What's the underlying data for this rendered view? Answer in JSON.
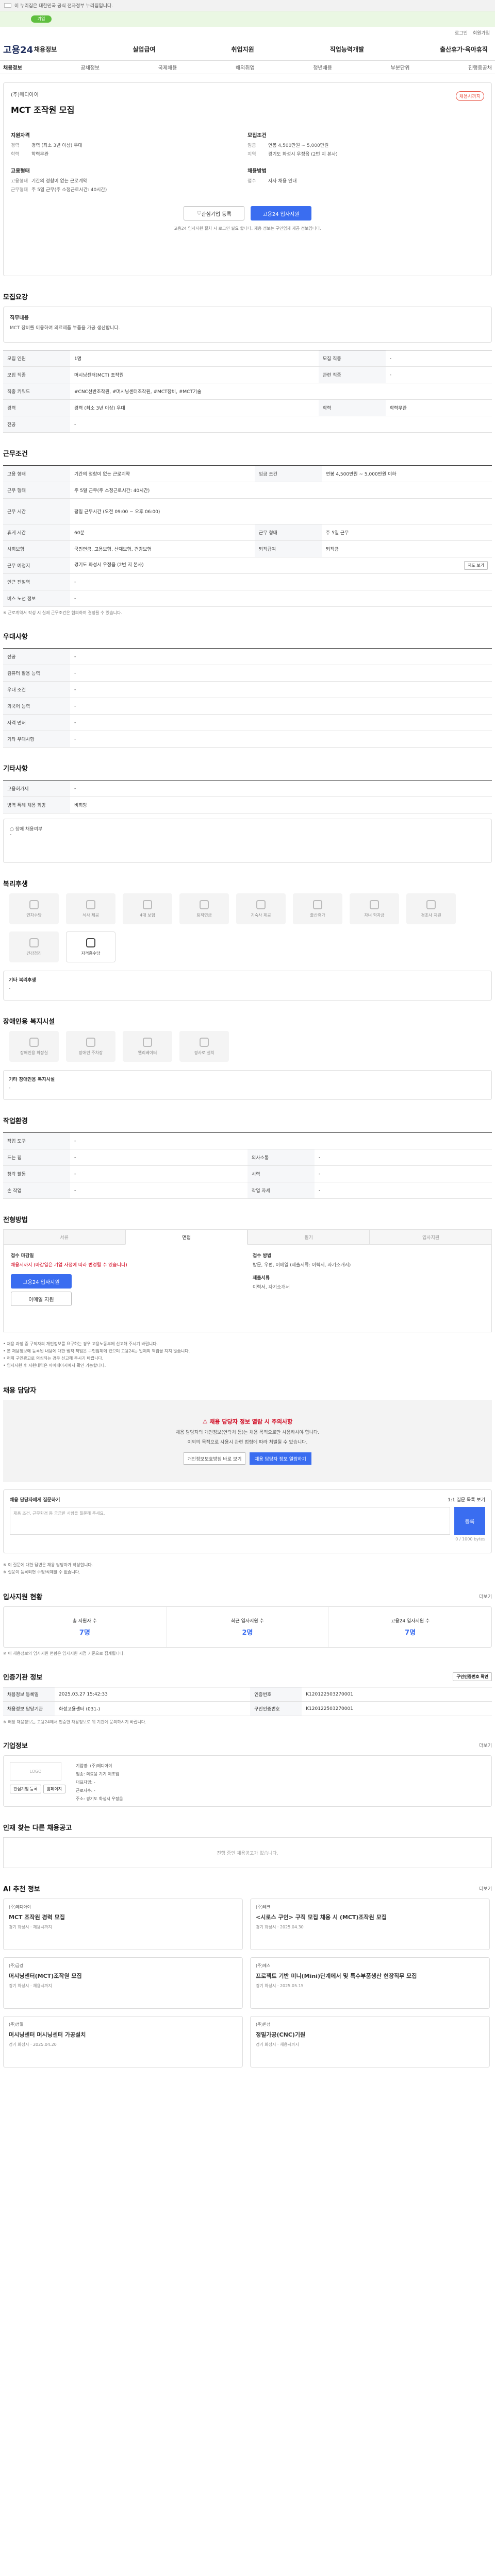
{
  "gov": "이 누리집은 대한민국 공식 전자정부 누리집입니다.",
  "notice": {
    "tag": "기업",
    "text": ""
  },
  "utility": [
    "로그인",
    "회원가입"
  ],
  "logo": "고용24",
  "gnb": [
    "채용정보",
    "실업급여",
    "취업지원",
    "직업능력개발",
    "출산휴가·육아휴직"
  ],
  "subnav": [
    "채용정보",
    "공채정보",
    "국제채용",
    "해외취업",
    "청년채용",
    "부분단위",
    "진행중공채"
  ],
  "summary": {
    "company": "(주)메디아이",
    "title": "MCT 조작원 모집",
    "badge": "채용시까지",
    "left_h1": "지원자격",
    "left_rows": [
      [
        "경력",
        "경력 (최소 3년 이상) 우대"
      ],
      [
        "학력",
        "학력무관"
      ]
    ],
    "left_h2": "고용형태",
    "left_rows2": [
      [
        "고용형태",
        "기간의 정함이 없는 근로계약"
      ],
      [
        "근무형태",
        "주 5일 근무(주 소정근로시간: 40시간)"
      ]
    ],
    "right_h1": "모집조건",
    "right_rows": [
      [
        "임금",
        "연봉 4,500만원 ~ 5,000만원"
      ],
      [
        "지역",
        "경기도 화성시 우정읍 (2번 지 본사)"
      ]
    ],
    "right_h2": "채용방법",
    "right_rows2": [
      [
        "접수",
        "자사 채용 안내"
      ]
    ],
    "btn_left": "관심기업 등록",
    "btn_right": "고용24 입사지원",
    "btns_note": "고용24 입사지원 절차 시 로그인 필요 합니다. 채용 정보는 구인업체 제공 정보입니다."
  },
  "intro": {
    "section": "모집요강",
    "h": "직무내용",
    "p": "MCT 장비를 이용하여 의료제품 부품을 가공 생산합니다."
  },
  "recruit_rows": [
    [
      "모집 인원",
      "1명",
      "모집 직종",
      "-"
    ],
    [
      "모집 직종",
      "머시닝센터(MCT) 조작원",
      "관련 직종",
      "-"
    ],
    [
      "직종 키워드",
      "#CNC선반조작원, #머시닝센터조작원, #MCT장비, #MCT기술",
      "",
      ""
    ],
    [
      "경력",
      "경력 (최소 3년 이상) 우대",
      "학력",
      "학력무관"
    ],
    [
      "전공",
      "-",
      "",
      ""
    ]
  ],
  "cond": {
    "section": "근무조건",
    "rows": [
      [
        "고용 형태",
        "기간의 정함이 없는 근로계약",
        "임금 조건",
        "연봉 4,500만원 ~ 5,000만원 이하"
      ],
      [
        "근무 형태",
        "주 5일 근무(주 소정근로시간: 40시간)",
        "",
        ""
      ],
      [
        "근무 시간",
        "평일 근무시간 (오전 09:00 ~ 오후 06:00)",
        "",
        ""
      ],
      [
        "휴게 시간",
        "60분",
        "근무 형태",
        "주 5일 근무"
      ],
      [
        "사회보험",
        "국민연금, 고용보험, 산재보험, 건강보험",
        "퇴직급여",
        "퇴직금"
      ],
      [
        "근무 예정지",
        "경기도 화성시 우정읍 (2번 지 본사)",
        "",
        ""
      ],
      [
        "인근 전철역",
        "-",
        "",
        ""
      ],
      [
        "버스 노선 정보",
        "-",
        "",
        ""
      ]
    ],
    "map_btn": "지도 보기",
    "note": "※ 근로계약서 작성 시 실제 근무조건은 협의하여 결정될 수 있습니다."
  },
  "prefer": {
    "section": "우대사항",
    "rows": [
      [
        "전공",
        "-"
      ],
      [
        "컴퓨터 활용 능력",
        "-"
      ],
      [
        "우대 조건",
        "-"
      ],
      [
        "외국어 능력",
        "-"
      ],
      [
        "자격 면허",
        "-"
      ],
      [
        "기타 우대사항",
        "-"
      ]
    ]
  },
  "etc": {
    "section": "기타사항",
    "rows": [
      [
        "고용허가제",
        "-"
      ],
      [
        "병역 특례 채용 희망",
        "비희망"
      ]
    ],
    "apply_note": "○ 장애 채용여부",
    "apply_val": "-"
  },
  "welfare": {
    "section": "복리후생",
    "cards": [
      [
        "연차수당",
        false
      ],
      [
        "식사 제공",
        false
      ],
      [
        "4대 보험",
        false
      ],
      [
        "퇴직연금",
        false
      ],
      [
        "기숙사 제공",
        false
      ],
      [
        "출산휴가",
        false
      ],
      [
        "자녀 학자금",
        false
      ],
      [
        "경조사 지원",
        false
      ],
      [
        "건강검진",
        false
      ],
      [
        "자격증수당",
        true
      ]
    ],
    "etc_h": "기타 복리후생",
    "etc_p": "-"
  },
  "disability": {
    "section": "장애인용 복지시설",
    "cards": [
      "장애인용 화장실",
      "장애인 주차장",
      "엘리베이터",
      "경사로 설치"
    ],
    "etc_h": "기타 장애인용 복지시설",
    "etc_p": "-"
  },
  "workenv": {
    "section": "작업환경",
    "rows": [
      [
        "작업 도구",
        "-",
        "",
        ""
      ],
      [
        "드는 힘",
        "-",
        "의사소통",
        "-"
      ],
      [
        "청각 활동",
        "-",
        "시력",
        "-"
      ],
      [
        "손 작업",
        "-",
        "작업 자세",
        "-"
      ]
    ]
  },
  "howto": {
    "section": "전형방법",
    "tabs": [
      "서류",
      "면접",
      "필기",
      "입사지원"
    ],
    "h1": "접수 마감일",
    "p1": "채용시까지 (마감일은 기업 사정에 따라 변경될 수 있습니다)",
    "apply_btn": "고용24 입사지원",
    "sub_btn": "이메일 지원",
    "h2": "접수 방법",
    "p2": "방문, 우편, 이메일 (제출서류: 이력서, 자기소개서)",
    "h3": "제출서류",
    "p3": "이력서, 자기소개서",
    "bullets": [
      "채용 과정 중 구직자의 개인정보를 요구하는 경우 고용노동부에 신고해 주시기 바랍니다.",
      "본 채용정보에 등록된 내용에 대한 법적 책임은 구인업체에 있으며 고용24는 일체의 책임을 지지 않습니다.",
      "허위 구인광고로 의심되는 경우 신고해 주시기 바랍니다.",
      "입사지원 후 지원내역은 마이페이지에서 확인 가능합니다."
    ]
  },
  "contact": {
    "section": "채용 담당자",
    "warn": "채용 담당자 정보 열람 시 주의사항",
    "p1": "채용 담당자의 개인정보(연락처 등)는 채용 목적으로만 사용하셔야 합니다.",
    "p2": "이외의 목적으로 사용시 관련 법령에 따라 처벌될 수 있습니다.",
    "btn1": "개인정보보호방침 바로 보기",
    "btn2": "채용 담당자 정보 열람하기",
    "q_h": "채용 담당자에게 질문하기",
    "q_right": "1:1 질문 목록 보기",
    "q_ph": "채용 조건, 근무환경 등 궁금한 사항을 질문해 주세요.",
    "q_btn": "등록",
    "q_count": "0 / 1000 bytes",
    "notes": [
      "이 질문에 대한 답변은 채용 담당자가 작성합니다.",
      "질문이 등록되면 수정/삭제할 수 없습니다."
    ]
  },
  "stats": {
    "section": "입사지원 현황",
    "more": "더보기",
    "items": [
      [
        "총 지원자 수",
        "7명"
      ],
      [
        "최근 입사지원 수",
        "2명"
      ],
      [
        "고용24 입사지원 수",
        "7명"
      ]
    ],
    "note": "※ 이 채용정보의 입사지원 현황은 입사지원 시점 기준으로 집계됩니다."
  },
  "info": {
    "section": "인증기관 정보",
    "btn": "구인인증번호 확인",
    "rows": [
      [
        "채용정보 등록일",
        "2025.03.27 15:42:33",
        "인증번호",
        "K120122503270001"
      ],
      [
        "채용정보 담당기관",
        "화성고용센터 (031-)",
        "구인인증번호",
        "K120122503270001"
      ]
    ],
    "note": "※ 해당 채용정보는 고용24에서 인증한 채용정보로 위 기관에 문의하시기 바랍니다."
  },
  "company": {
    "section": "기업정보",
    "more": "더보기",
    "logo": "LOGO",
    "btn1": "관심기업 등록",
    "btn2": "홈페이지",
    "kv": [
      "기업명: (주)메디아이",
      "업종: 의료용 기기 제조업",
      "대표자명: -",
      "근로자수: -",
      "주소: 경기도 화성시 우정읍"
    ]
  },
  "other": {
    "section": "인재 찾는 다른 채용공고",
    "empty": "진행 중인 채용공고가 없습니다."
  },
  "recs": {
    "section": "AI 추천 정보",
    "more": "더보기",
    "items": [
      {
        "co": "(주)메디아이",
        "title": "MCT 조작원 경력 모집",
        "meta": "경기 화성시 · 채용시까지"
      },
      {
        "co": "(주)테크",
        "title": "<시로스 구인> 구직 모집 채용 시 (MCT)조작원 모집",
        "meta": "경기 화성시 · 2025.04.30"
      },
      {
        "co": "(주)금강",
        "title": "머시닝센터(MCT)조작원 모집",
        "meta": "경기 화성시 · 채용시까지"
      },
      {
        "co": "(주)에스",
        "title": "프로젝트 기반 미니(Mini)단계에서 및 특수부품생산 현장직무 모집",
        "meta": "경기 화성시 · 2025.05.15"
      },
      {
        "co": "(주)정밀",
        "title": "머시닝센터 머시닝센터 가공설치",
        "meta": "경기 화성시 · 2025.04.20"
      },
      {
        "co": "(주)한성",
        "title": "정밀가공(CNC)기원",
        "meta": "경기 화성시 · 채용시까지"
      }
    ]
  }
}
